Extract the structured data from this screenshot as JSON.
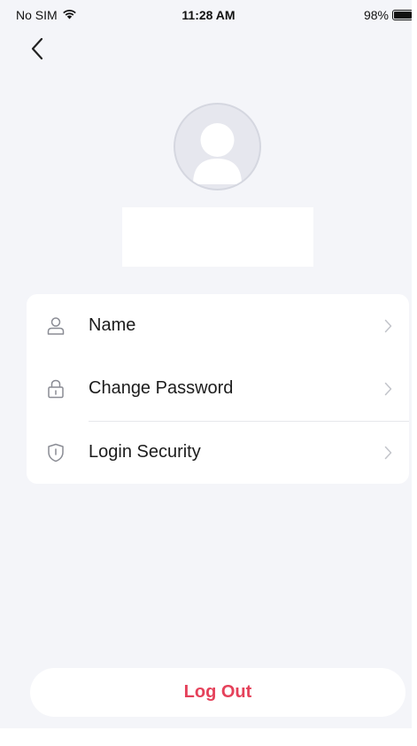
{
  "status_bar": {
    "carrier": "No SIM",
    "time": "11:28 AM",
    "battery_percent": "98%",
    "battery_level": 0.98,
    "wifi_icon": "wifi-icon",
    "battery_icon": "battery-icon"
  },
  "nav": {
    "back_icon": "chevron-left-icon"
  },
  "profile": {
    "avatar_icon": "user-avatar-icon"
  },
  "menu": {
    "items": [
      {
        "label": "Name",
        "icon": "user-icon"
      },
      {
        "label": "Change Password",
        "icon": "lock-icon"
      },
      {
        "label": "Login Security",
        "icon": "shield-icon"
      }
    ],
    "chevron_icon": "chevron-right-icon"
  },
  "logout": {
    "label": "Log Out",
    "color": "#e5415a"
  },
  "colors": {
    "background": "#f4f5f9",
    "card": "#ffffff",
    "accent_danger": "#e5415a",
    "icon_gray": "#8a8c94",
    "chevron_gray": "#c2c4ca"
  }
}
